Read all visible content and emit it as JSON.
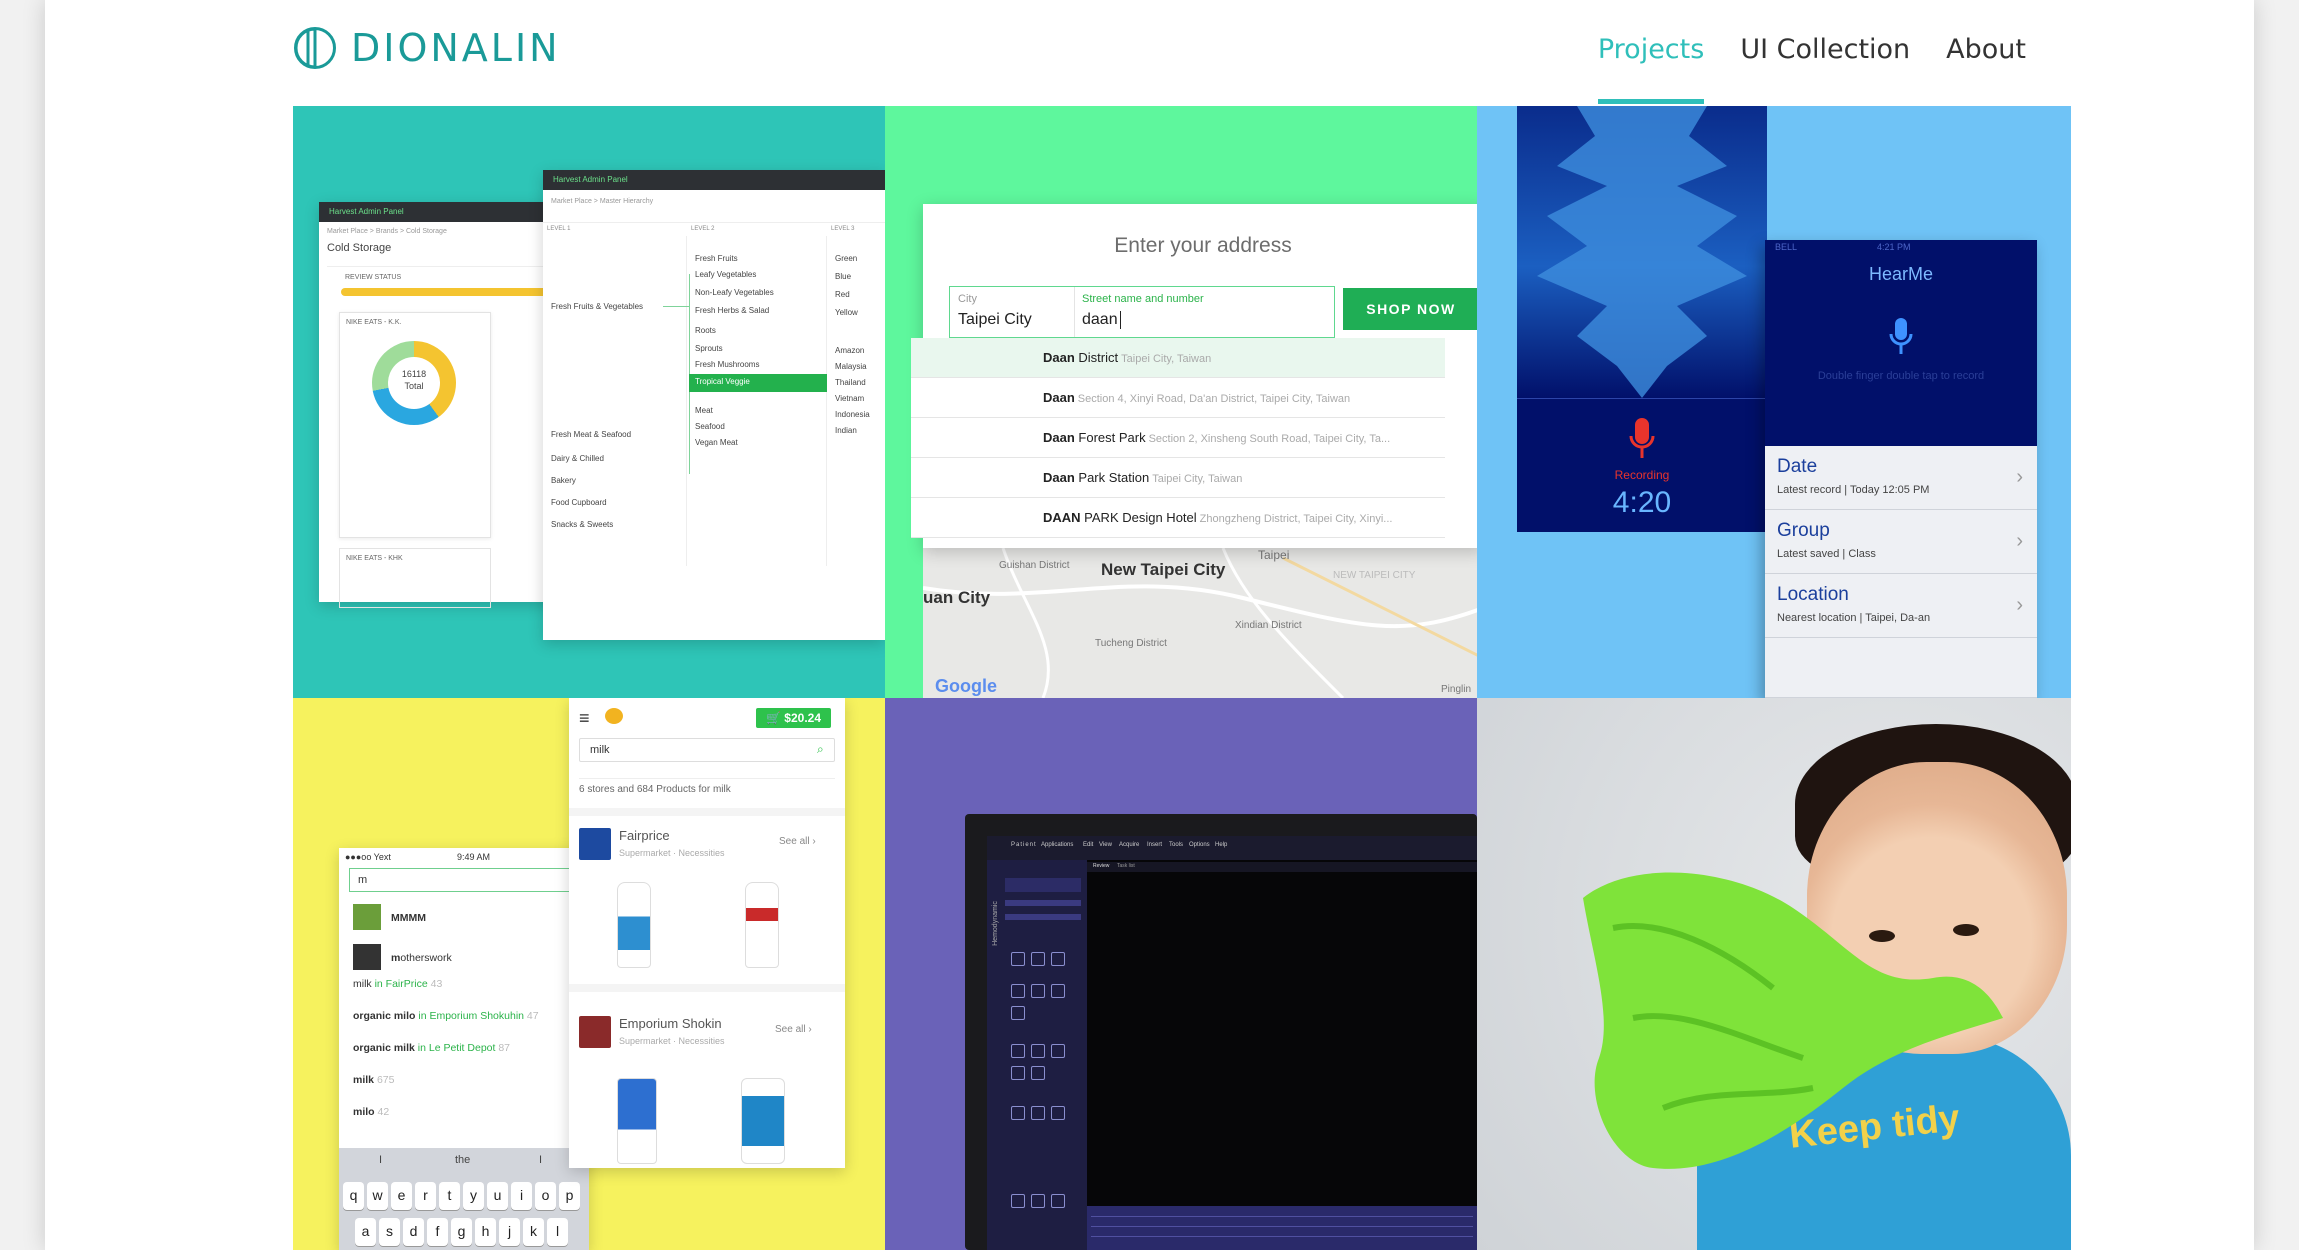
{
  "header": {
    "brand": "DIONALIN",
    "nav": [
      {
        "label": "Projects",
        "active": true
      },
      {
        "label": "UI Collection",
        "active": false
      },
      {
        "label": "About",
        "active": false
      }
    ]
  },
  "colors": {
    "accent": "#2fbfba",
    "brand": "#1a9a98",
    "tile_teal": "#2ec5b7",
    "tile_mint": "#5ef79d",
    "tile_sky": "#6fc3f6",
    "tile_yellow": "#f6f25e",
    "tile_purple": "#6a62b8"
  },
  "admin": {
    "bar_title": "Harvest Admin Panel",
    "breadcrumb_a": "Market Place > Brands > Cold Storage",
    "title_a": "Cold Storage",
    "review_status": "REVIEW STATUS",
    "card_a": "NIKE EATS - K.K.",
    "donut_value": "16118",
    "donut_label": "Total",
    "card_b": "NIKE EATS - KHK",
    "breadcrumb_b": "Market Place > Master Hierarchy",
    "level1": "LEVEL 1",
    "level2": "LEVEL 2",
    "level3": "LEVEL 3",
    "l1_items": [
      "Fresh Fruits & Vegetables",
      "Fresh Meat & Seafood",
      "Dairy & Chilled",
      "Bakery",
      "Food Cupboard",
      "Snacks & Sweets"
    ],
    "l2_items": [
      "Fresh Fruits",
      "Leafy Vegetables",
      "Non-Leafy Vegetables",
      "Fresh Herbs & Salad",
      "Roots",
      "Sprouts",
      "Fresh Mushrooms",
      "Tropical Veggie",
      "Meat",
      "Seafood",
      "Vegan Meat"
    ],
    "l3_items": [
      "Green",
      "Blue",
      "Red",
      "Yellow",
      "Amazon",
      "Malaysia",
      "Thailand",
      "Vietnam",
      "Indonesia",
      "Indian"
    ]
  },
  "address": {
    "title": "Enter your address",
    "city_label": "City",
    "city_value": "Taipei City",
    "street_label": "Street name and number",
    "street_value": "daan",
    "button": "SHOP NOW",
    "suggestions": [
      {
        "bold": "Daan",
        "main": " District",
        "rest": "Taipei City, Taiwan"
      },
      {
        "bold": "Daan",
        "main": "",
        "rest": "Section 4, Xinyi Road, Da'an District, Taipei City, Taiwan"
      },
      {
        "bold": "Daan",
        "main": " Forest Park",
        "rest": "Section 2, Xinsheng South Road, Taipei City, Ta..."
      },
      {
        "bold": "Daan",
        "main": " Park Station",
        "rest": "Taipei City, Taiwan"
      },
      {
        "bold": "DAAN",
        "main": " PARK Design Hotel",
        "rest": "Zhongzheng District, Taipei City, Xinyi..."
      }
    ],
    "map_labels": [
      "New Taipei City",
      "uan City",
      "Taipei",
      "Guishan District",
      "Tucheng District",
      "Xindian District",
      "NEW TAIPEI CITY",
      "Pinglin"
    ],
    "map_provider": "Google"
  },
  "hearme": {
    "recording": "Recording",
    "timer": "4:20",
    "carrier": "BELL",
    "clock": "4:21 PM",
    "app_title": "HearMe",
    "hint": "Double finger double tap to record",
    "rows": [
      {
        "title": "Date",
        "sub": "Latest record | Today 12:05 PM"
      },
      {
        "title": "Group",
        "sub": "Latest saved | Class"
      },
      {
        "title": "Location",
        "sub": "Nearest location | Taipei, Da-an"
      }
    ]
  },
  "grocery": {
    "carrier": "●●●oo Yext",
    "time": "9:49 AM",
    "typed": "m",
    "results": [
      {
        "pre": "",
        "bold": "MMMM",
        "post": "",
        "qty": ""
      },
      {
        "pre": "",
        "bold": "m",
        "post": "otherswork",
        "qty": ""
      }
    ],
    "suggestions": [
      {
        "a": "milk",
        "b": " in FairPrice",
        "c": "43"
      },
      {
        "a": "organic milo",
        "b": " in Emporium Shokuhin",
        "c": "47"
      },
      {
        "a": "organic milk",
        "b": " in Le Petit Depot",
        "c": "87"
      },
      {
        "a": "milk",
        "b": "",
        "c": "675"
      },
      {
        "a": "milo",
        "b": "",
        "c": "42"
      }
    ],
    "keyboard_row1": [
      "q",
      "w",
      "e",
      "r",
      "t",
      "y",
      "u",
      "i",
      "o",
      "p"
    ],
    "keyboard_row2": [
      "a",
      "s",
      "d",
      "f",
      "g",
      "h",
      "j",
      "k",
      "l"
    ],
    "suggest_bar": [
      "I",
      "the",
      "I"
    ],
    "price": "$20.24",
    "search_value": "milk",
    "summary": "6 stores and 684 Products for milk",
    "stores": [
      {
        "name": "Fairprice",
        "meta": "Supermarket · Necessities",
        "see_all": "See all ›"
      },
      {
        "name": "Emporium Shokin",
        "meta": "Supermarket · Necessities",
        "see_all": "See all ›"
      }
    ]
  },
  "clinical": {
    "app_title": "Hemodynamic",
    "menu": [
      "Patient",
      "Applications",
      "Edit",
      "View",
      "Acquire",
      "Insert",
      "Tools",
      "Options",
      "Help"
    ],
    "tabs": [
      "Review",
      "Task list"
    ]
  },
  "photo": {
    "shirt_text": "Keep tidy"
  }
}
